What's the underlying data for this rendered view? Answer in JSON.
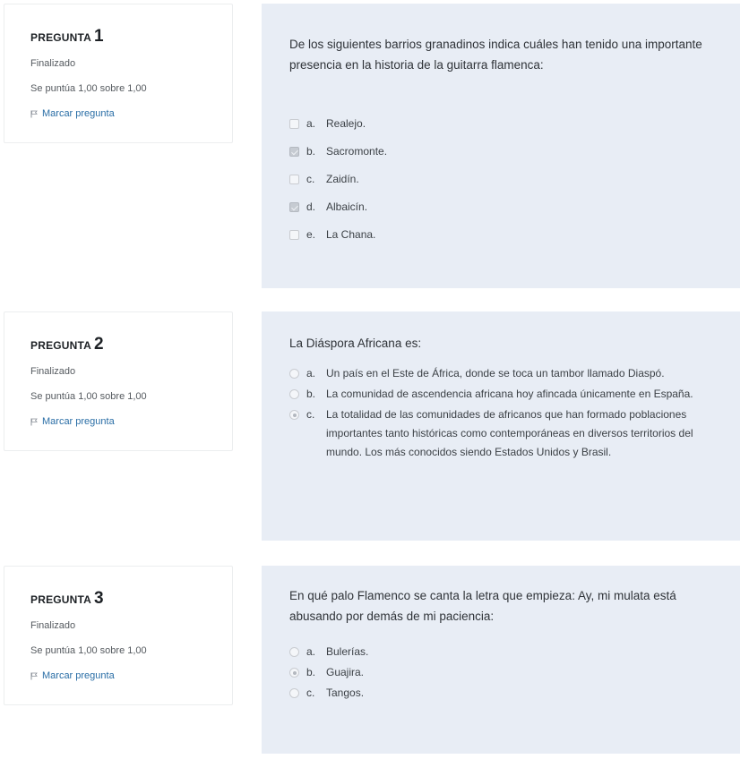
{
  "questions": [
    {
      "label": "PREGUNTA",
      "number": "1",
      "state": "Finalizado",
      "grade": "Se puntúa 1,00 sobre 1,00",
      "flag": "Marcar pregunta",
      "text": "De los siguientes barrios granadinos indica cuáles han tenido una importante presencia en la historia de la guitarra flamenca:",
      "type": "checkbox",
      "options": [
        {
          "letter": "a.",
          "text": "Realejo.",
          "checked": false
        },
        {
          "letter": "b.",
          "text": "Sacromonte.",
          "checked": true
        },
        {
          "letter": "c.",
          "text": "Zaidín.",
          "checked": false
        },
        {
          "letter": "d.",
          "text": "Albaicín.",
          "checked": true
        },
        {
          "letter": "e.",
          "text": "La Chana.",
          "checked": false
        }
      ]
    },
    {
      "label": "PREGUNTA",
      "number": "2",
      "state": "Finalizado",
      "grade": "Se puntúa 1,00 sobre 1,00",
      "flag": "Marcar pregunta",
      "text": "La Diáspora Africana es:",
      "type": "radio",
      "options": [
        {
          "letter": "a.",
          "text": "Un país en el Este de África, donde se toca un tambor llamado Diaspó.",
          "checked": false
        },
        {
          "letter": "b.",
          "text": "La comunidad de ascendencia africana hoy afincada únicamente en España.",
          "checked": false
        },
        {
          "letter": "c.",
          "text": "La totalidad de las comunidades de africanos que han formado poblaciones importantes tanto históricas como contemporáneas en diversos territorios del mundo. Los más conocidos siendo Estados Unidos y Brasil.",
          "checked": true
        }
      ]
    },
    {
      "label": "PREGUNTA",
      "number": "3",
      "state": "Finalizado",
      "grade": "Se puntúa 1,00 sobre 1,00",
      "flag": "Marcar pregunta",
      "text": "En qué palo Flamenco se canta la letra que empieza: Ay, mi mulata está abusando por demás de mi paciencia:",
      "type": "radio",
      "options": [
        {
          "letter": "a.",
          "text": "Bulerías.",
          "checked": false
        },
        {
          "letter": "b.",
          "text": "Guajira.",
          "checked": true
        },
        {
          "letter": "c.",
          "text": "Tangos.",
          "checked": false
        }
      ]
    }
  ],
  "colors": {
    "panel_bg": "#e8edf5",
    "link": "#2a6ea6",
    "title": "#1d2125"
  }
}
